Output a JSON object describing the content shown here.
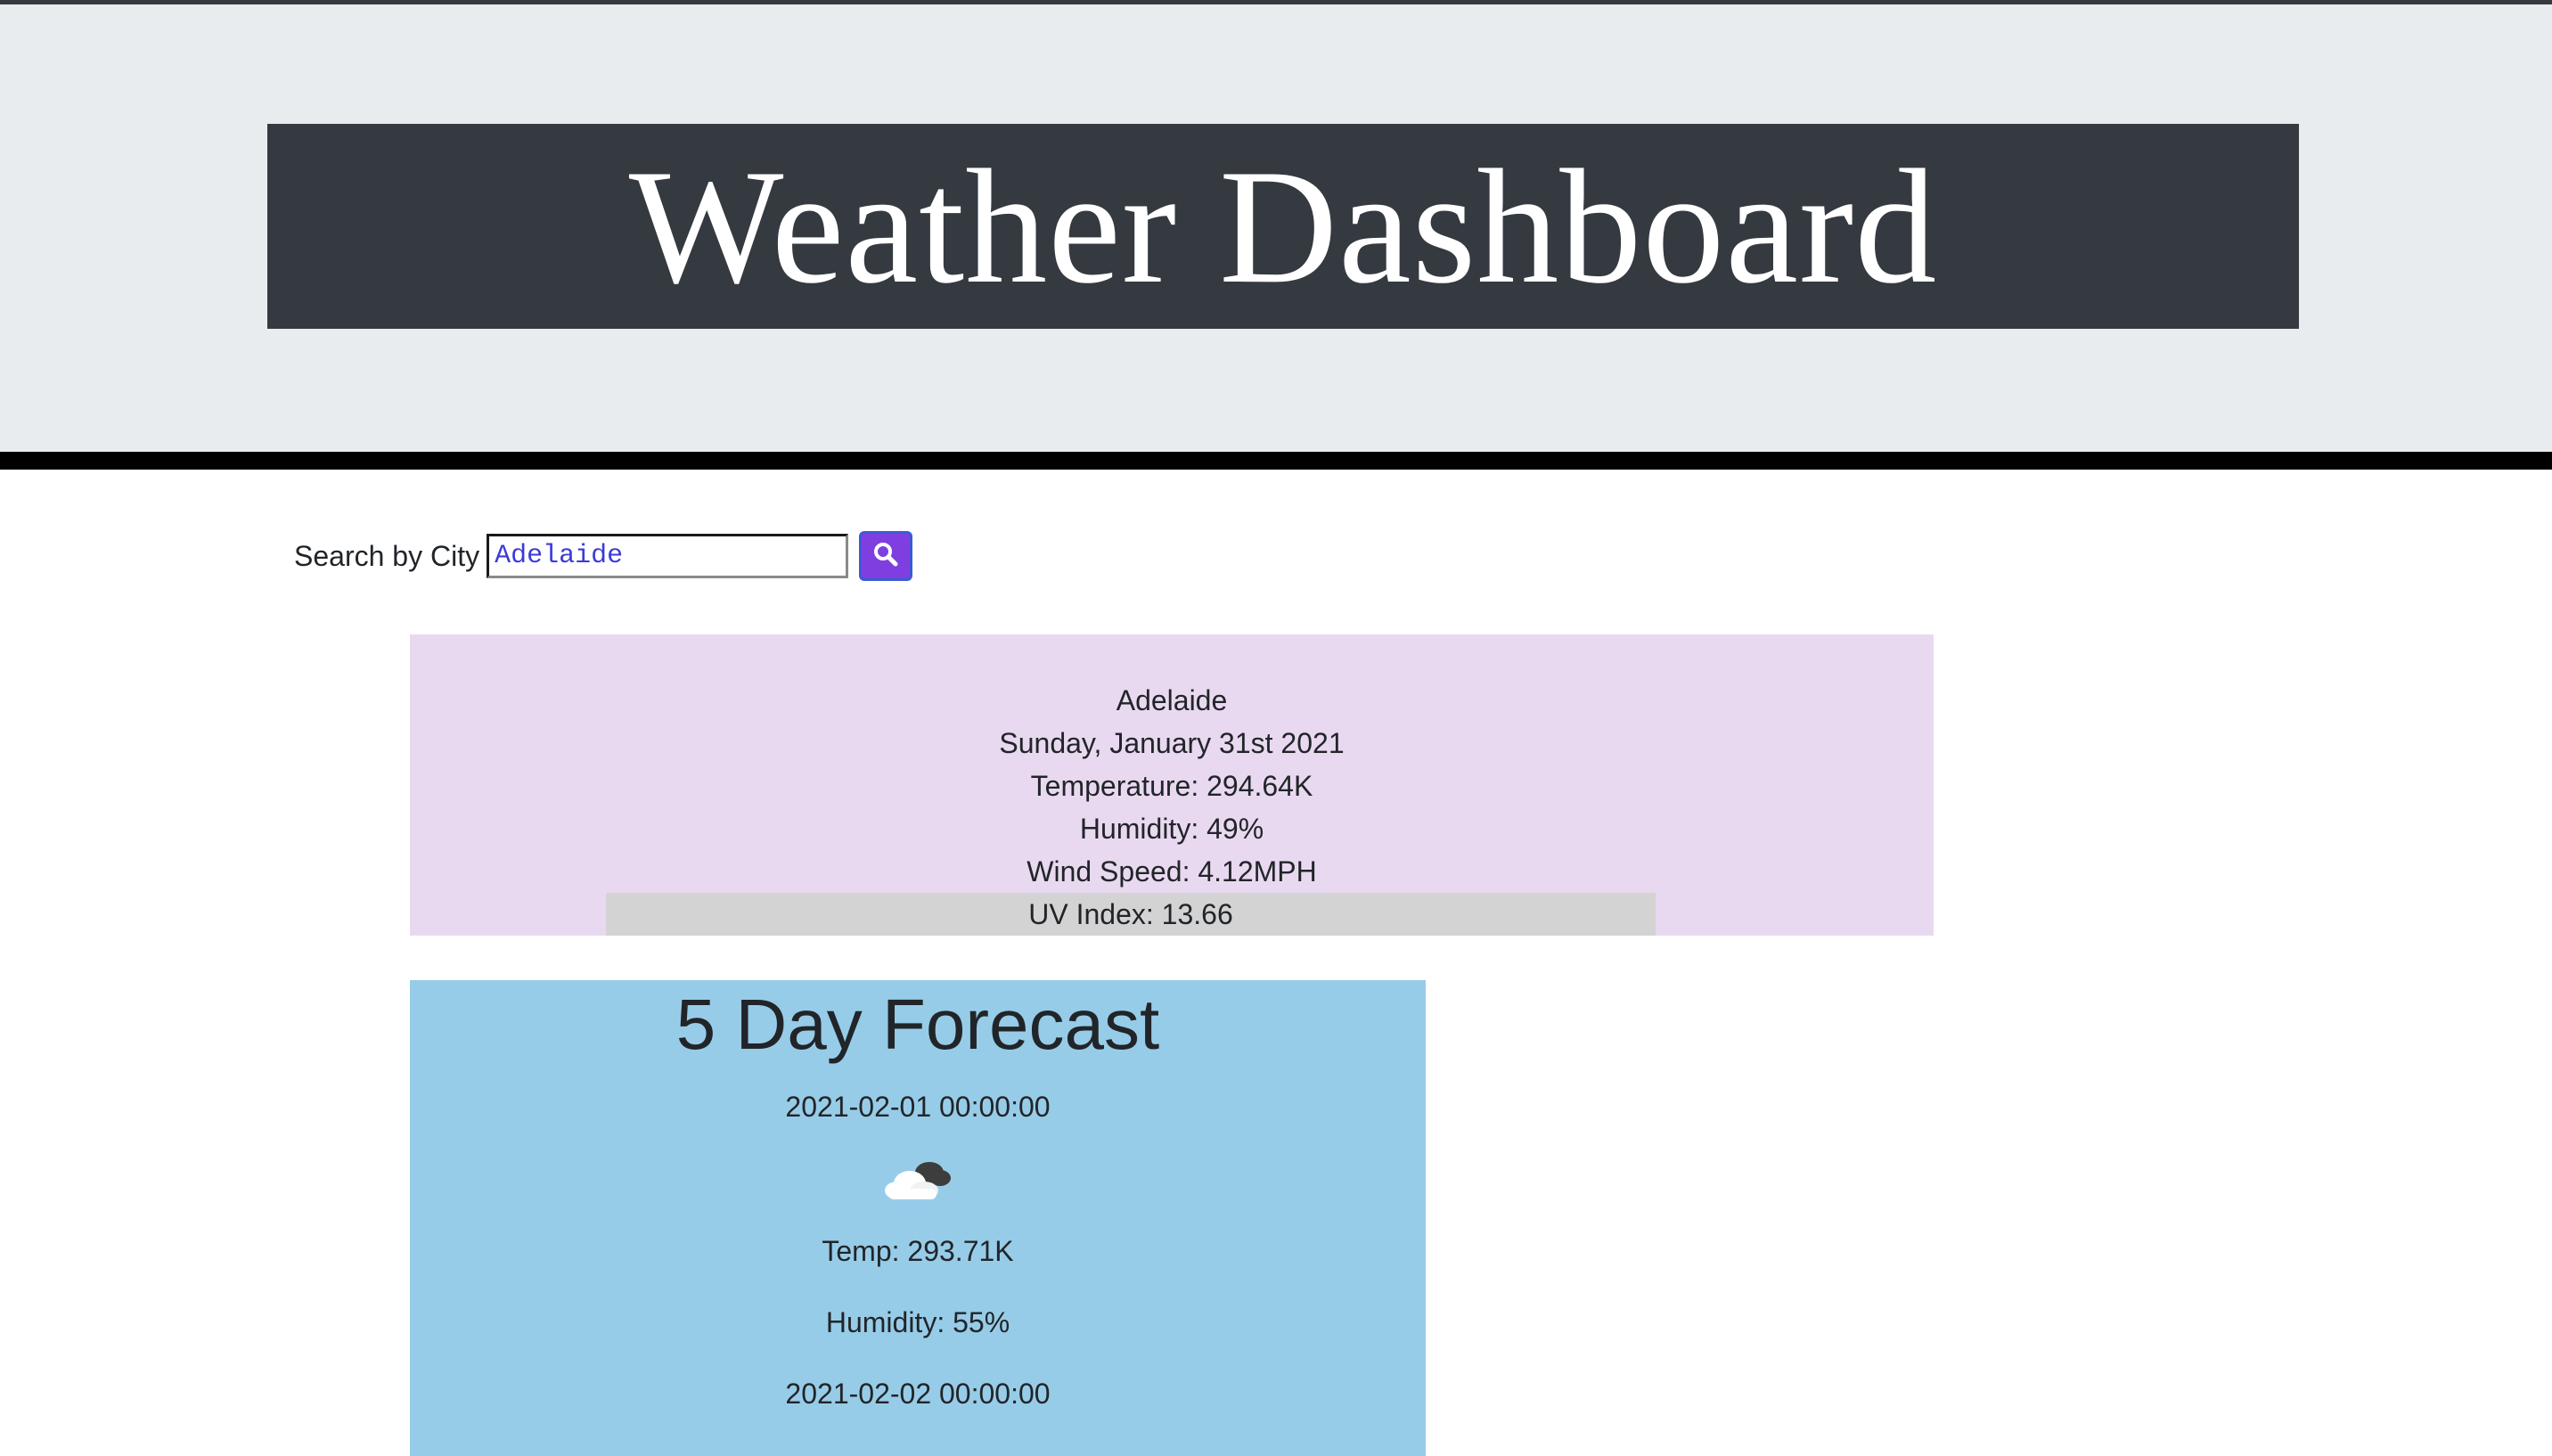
{
  "header": {
    "title": "Weather Dashboard"
  },
  "search": {
    "label": "Search by City",
    "value": "Adelaide",
    "button_icon": "search-icon",
    "button_color": "#7f3fe0"
  },
  "current": {
    "city": "Adelaide",
    "date": "Sunday, January 31st 2021",
    "temperature": "Temperature: 294.64K",
    "humidity": "Humidity: 49%",
    "wind": "Wind Speed: 4.12MPH",
    "uv": "UV Index: 13.66",
    "background": "#e9d9f0"
  },
  "forecast": {
    "heading": "5 Day Forecast",
    "background": "#97cce8",
    "days": [
      {
        "date": "2021-02-01 00:00:00",
        "icon": "cloud-icon",
        "temp": "Temp: 293.71K",
        "humidity": "Humidity: 55%"
      },
      {
        "date": "2021-02-02 00:00:00"
      }
    ]
  }
}
